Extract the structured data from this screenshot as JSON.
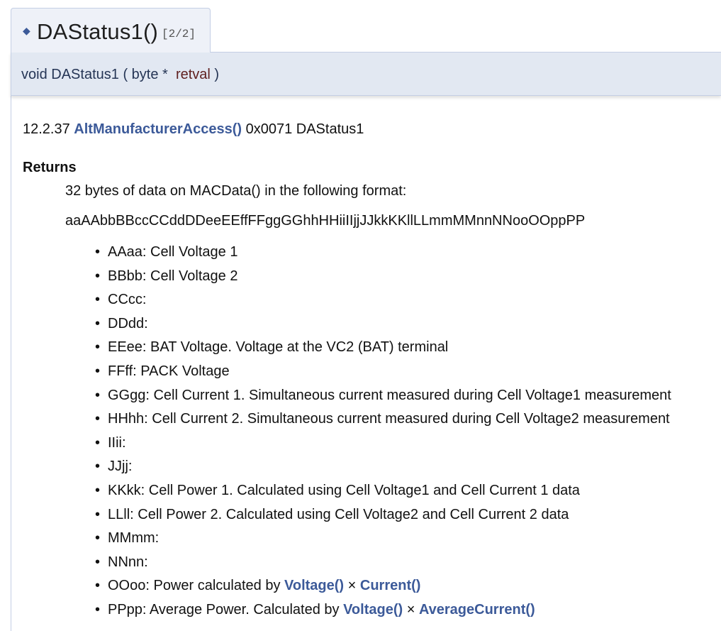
{
  "header": {
    "diamond": "◆",
    "function_name": "DAStatus1()",
    "overload": "[2/2]"
  },
  "prototype": {
    "return_type": "void",
    "name": "DAStatus1",
    "open_paren": "(",
    "param_type": "byte *",
    "param_name": "retval",
    "close_paren": ")"
  },
  "doc": {
    "section_number": "12.2.37",
    "command_link": "AltManufacturerAccess()",
    "command_rest": "0x0071 DAStatus1",
    "returns_label": "Returns",
    "returns_text": "32 bytes of data on MACData() in the following format:",
    "format_string": "aaAAbbBBccCCddDDeeEEffFFggGGhhHHiiIIjjJJkkKKllLLmmMMnnNNooOOppPP",
    "items": [
      {
        "text": "AAaa: Cell Voltage 1"
      },
      {
        "text": "BBbb: Cell Voltage 2"
      },
      {
        "text": "CCcc:"
      },
      {
        "text": "DDdd:"
      },
      {
        "text": "EEee: BAT Voltage. Voltage at the VC2 (BAT) terminal"
      },
      {
        "text": "FFff: PACK Voltage"
      },
      {
        "text": "GGgg: Cell Current 1. Simultaneous current measured during Cell Voltage1 measurement"
      },
      {
        "text": "HHhh: Cell Current 2. Simultaneous current measured during Cell Voltage2 measurement"
      },
      {
        "text": "IIii:"
      },
      {
        "text": "JJjj:"
      },
      {
        "text": "KKkk: Cell Power 1. Calculated using Cell Voltage1 and Cell Current 1 data"
      },
      {
        "text": "LLll: Cell Power 2. Calculated using Cell Voltage2 and Cell Current 2 data"
      },
      {
        "text": "MMmm:"
      },
      {
        "text": "NNnn:"
      },
      {
        "text": "OOoo: Power calculated by ",
        "link1": "Voltage()",
        "sep": " × ",
        "link2": "Current()"
      },
      {
        "text": "PPpp: Average Power. Calculated by ",
        "link1": "Voltage()",
        "sep": " × ",
        "link2": "AverageCurrent()"
      }
    ]
  },
  "colors": {
    "link": "#3c5a99",
    "param_name": "#602020",
    "title_bg": "#eef1f8",
    "proto_bg": "#e2e8f2",
    "border": "#c4cfe5"
  }
}
